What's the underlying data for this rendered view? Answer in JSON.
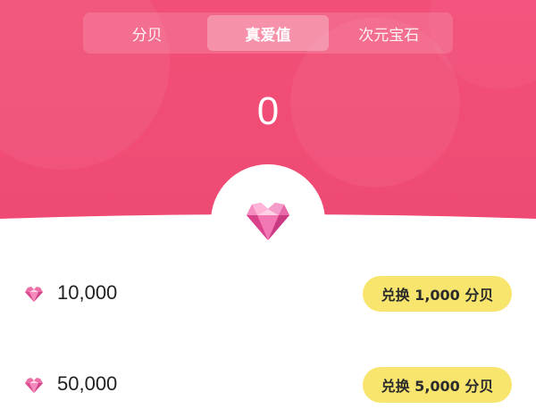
{
  "tabs": [
    {
      "label": "分贝",
      "active": false
    },
    {
      "label": "真爱值",
      "active": true
    },
    {
      "label": "次元宝石",
      "active": false
    }
  ],
  "balance": "0",
  "colors": {
    "gradient_top": "#f3527a",
    "gradient_bottom": "#ee4a72",
    "button_yellow": "#f7e56e"
  },
  "exchange_items": [
    {
      "amount": "10,000",
      "button_label": "兑换 1,000 分贝"
    },
    {
      "amount": "50,000",
      "button_label": "兑换 5,000 分贝"
    }
  ]
}
